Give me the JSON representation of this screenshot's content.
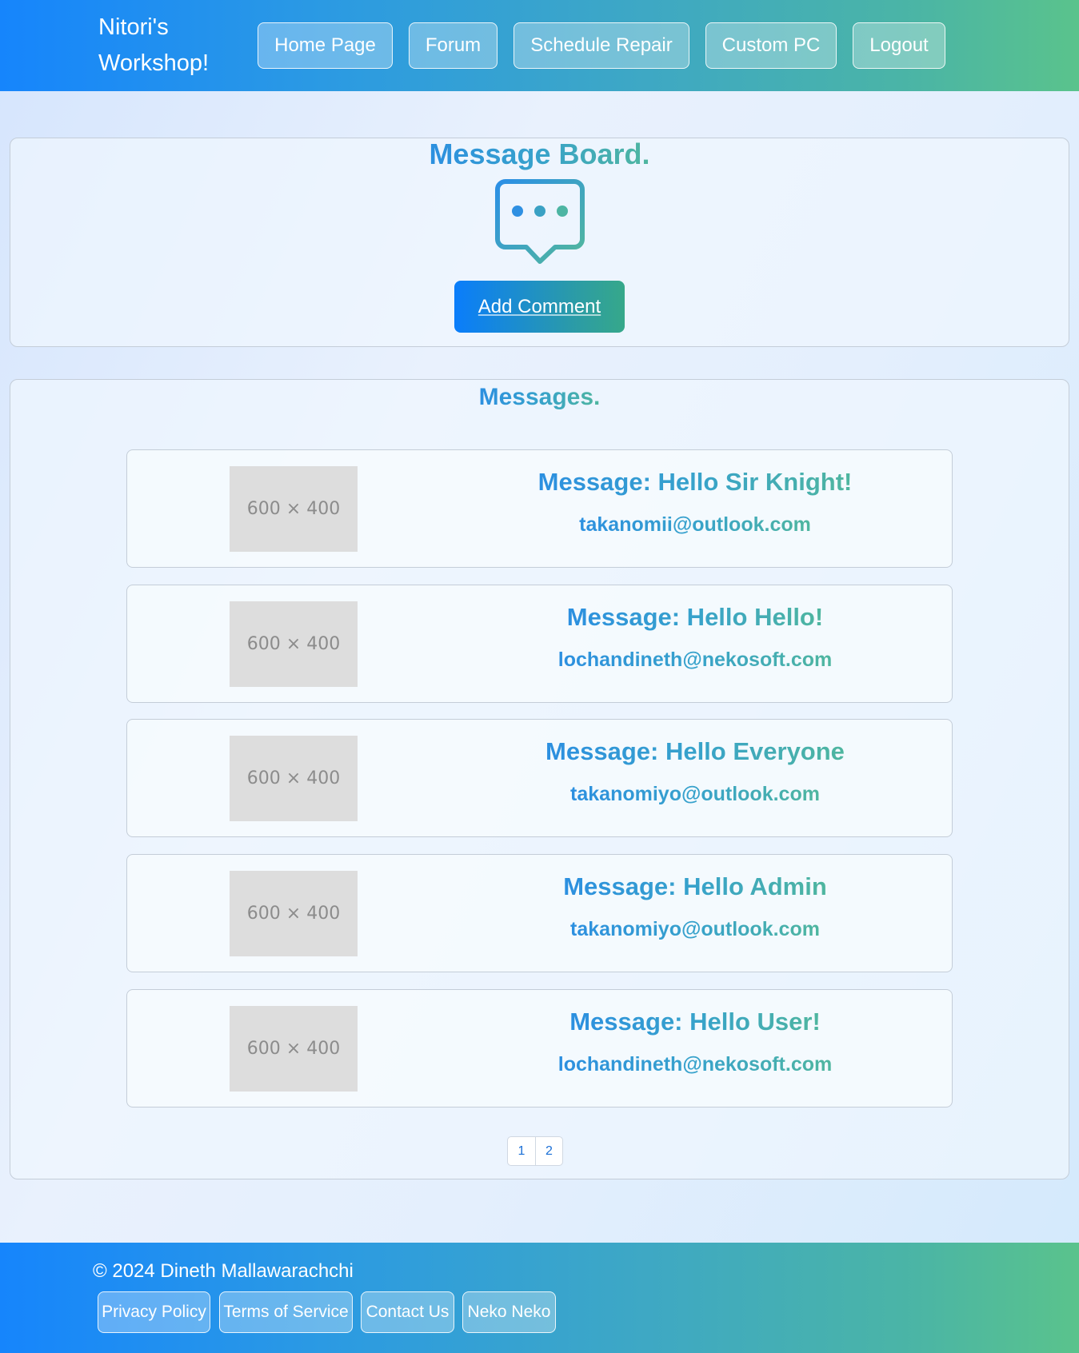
{
  "header": {
    "brand": "Nitori's Workshop!",
    "nav": [
      {
        "label": "Home Page"
      },
      {
        "label": "Forum"
      },
      {
        "label": "Schedule Repair"
      },
      {
        "label": "Custom PC"
      },
      {
        "label": "Logout"
      }
    ]
  },
  "board": {
    "title": "Message Board.",
    "icon": "chat-bubble-icon",
    "add_button": "Add Comment"
  },
  "messages": {
    "title": "Messages.",
    "items": [
      {
        "image_label": "600 × 400",
        "title": "Message: Hello Sir Knight!",
        "email": "takanomii@outlook.com"
      },
      {
        "image_label": "600 × 400",
        "title": "Message: Hello Hello!",
        "email": "lochandineth@nekosoft.com"
      },
      {
        "image_label": "600 × 400",
        "title": "Message: Hello Everyone",
        "email": "takanomiyo@outlook.com"
      },
      {
        "image_label": "600 × 400",
        "title": "Message: Hello Admin",
        "email": "takanomiyo@outlook.com"
      },
      {
        "image_label": "600 × 400",
        "title": "Message: Hello User!",
        "email": "lochandineth@nekosoft.com"
      }
    ],
    "pagination": [
      "1",
      "2"
    ]
  },
  "footer": {
    "copyright": "© 2024 Dineth Mallawarachchi",
    "links": [
      {
        "label": "Privacy Policy"
      },
      {
        "label": "Terms of Service"
      },
      {
        "label": "Contact Us"
      },
      {
        "label": "Neko Neko"
      }
    ]
  },
  "colors": {
    "header_gradient_start": "#1685fc",
    "header_gradient_end": "#5ac38c",
    "accent_blue": "#2c8fe0",
    "accent_green": "#4fb69f"
  }
}
